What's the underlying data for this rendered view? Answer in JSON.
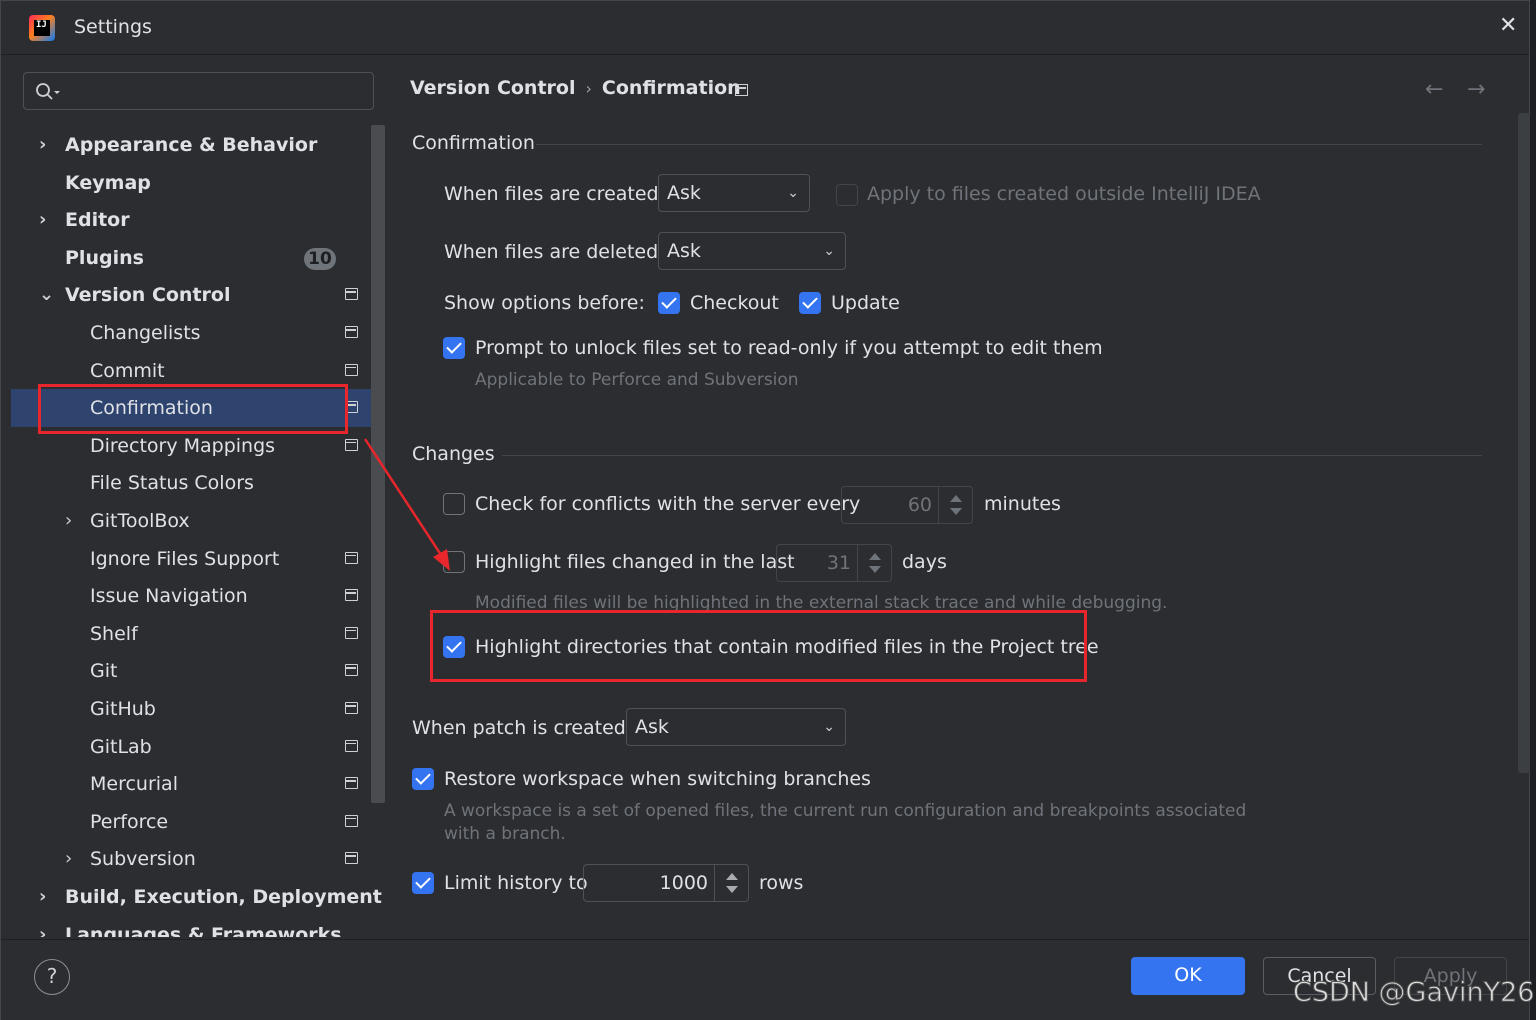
{
  "window": {
    "title": "Settings"
  },
  "search": {
    "placeholder": ""
  },
  "sidebar": {
    "items": [
      {
        "label": "Appearance & Behavior",
        "chevron": "›",
        "bold": true
      },
      {
        "label": "Keymap",
        "bold": true
      },
      {
        "label": "Editor",
        "chevron": "›",
        "bold": true
      },
      {
        "label": "Plugins",
        "bold": true,
        "badge": "10"
      },
      {
        "label": "Version Control",
        "chevron": "⌄",
        "bold": true
      },
      {
        "label": "Changelists"
      },
      {
        "label": "Commit"
      },
      {
        "label": "Confirmation",
        "selected": true
      },
      {
        "label": "Directory Mappings"
      },
      {
        "label": "File Status Colors"
      },
      {
        "label": "GitToolBox",
        "chevron": "›"
      },
      {
        "label": "Ignore Files Support"
      },
      {
        "label": "Issue Navigation"
      },
      {
        "label": "Shelf"
      },
      {
        "label": "Git"
      },
      {
        "label": "GitHub"
      },
      {
        "label": "GitLab"
      },
      {
        "label": "Mercurial"
      },
      {
        "label": "Perforce"
      },
      {
        "label": "Subversion",
        "chevron": "›"
      },
      {
        "label": "Build, Execution, Deployment",
        "chevron": "›",
        "bold": true
      },
      {
        "label": "Languages & Frameworks",
        "chevron": "›",
        "bold": true
      }
    ]
  },
  "breadcrumb": {
    "parent": "Version Control",
    "separator": "›",
    "current": "Confirmation"
  },
  "nav": {
    "back": "←",
    "forward": "→"
  },
  "confirmation": {
    "heading": "Confirmation",
    "files_created_label": "When files are created:",
    "files_created_value": "Ask",
    "apply_outside_label": "Apply to files created outside IntelliJ IDEA",
    "files_deleted_label": "When files are deleted:",
    "files_deleted_value": "Ask",
    "show_options_label": "Show options before:",
    "checkout_label": "Checkout",
    "update_label": "Update",
    "prompt_unlock_label": "Prompt to unlock files set to read-only if you attempt to edit them",
    "prompt_unlock_hint": "Applicable to Perforce and Subversion"
  },
  "changes": {
    "heading": "Changes",
    "check_conflicts_label": "Check for conflicts with the server every",
    "check_conflicts_value": "60",
    "minutes_label": "minutes",
    "highlight_changed_label": "Highlight files changed in the last",
    "highlight_changed_value": "31",
    "days_label": "days",
    "highlight_changed_hint": "Modified files will be highlighted in the external stack trace and while debugging.",
    "highlight_dirs_label": "Highlight directories that contain modified files in the Project tree",
    "patch_label": "When patch is created:",
    "patch_value": "Ask",
    "restore_workspace_label": "Restore workspace when switching branches",
    "restore_workspace_hint_1": "A workspace is a set of opened files, the current run configuration and breakpoints associated",
    "restore_workspace_hint_2": "with a branch.",
    "limit_history_label": "Limit history to",
    "limit_history_value": "1000",
    "rows_label": "rows"
  },
  "footer": {
    "help": "?",
    "ok": "OK",
    "cancel": "Cancel",
    "apply": "Apply"
  },
  "watermark": "CSDN @GavinY26",
  "colors": {
    "accent": "#3574f0",
    "selection": "#2e436e",
    "annotation": "#e8262b"
  }
}
